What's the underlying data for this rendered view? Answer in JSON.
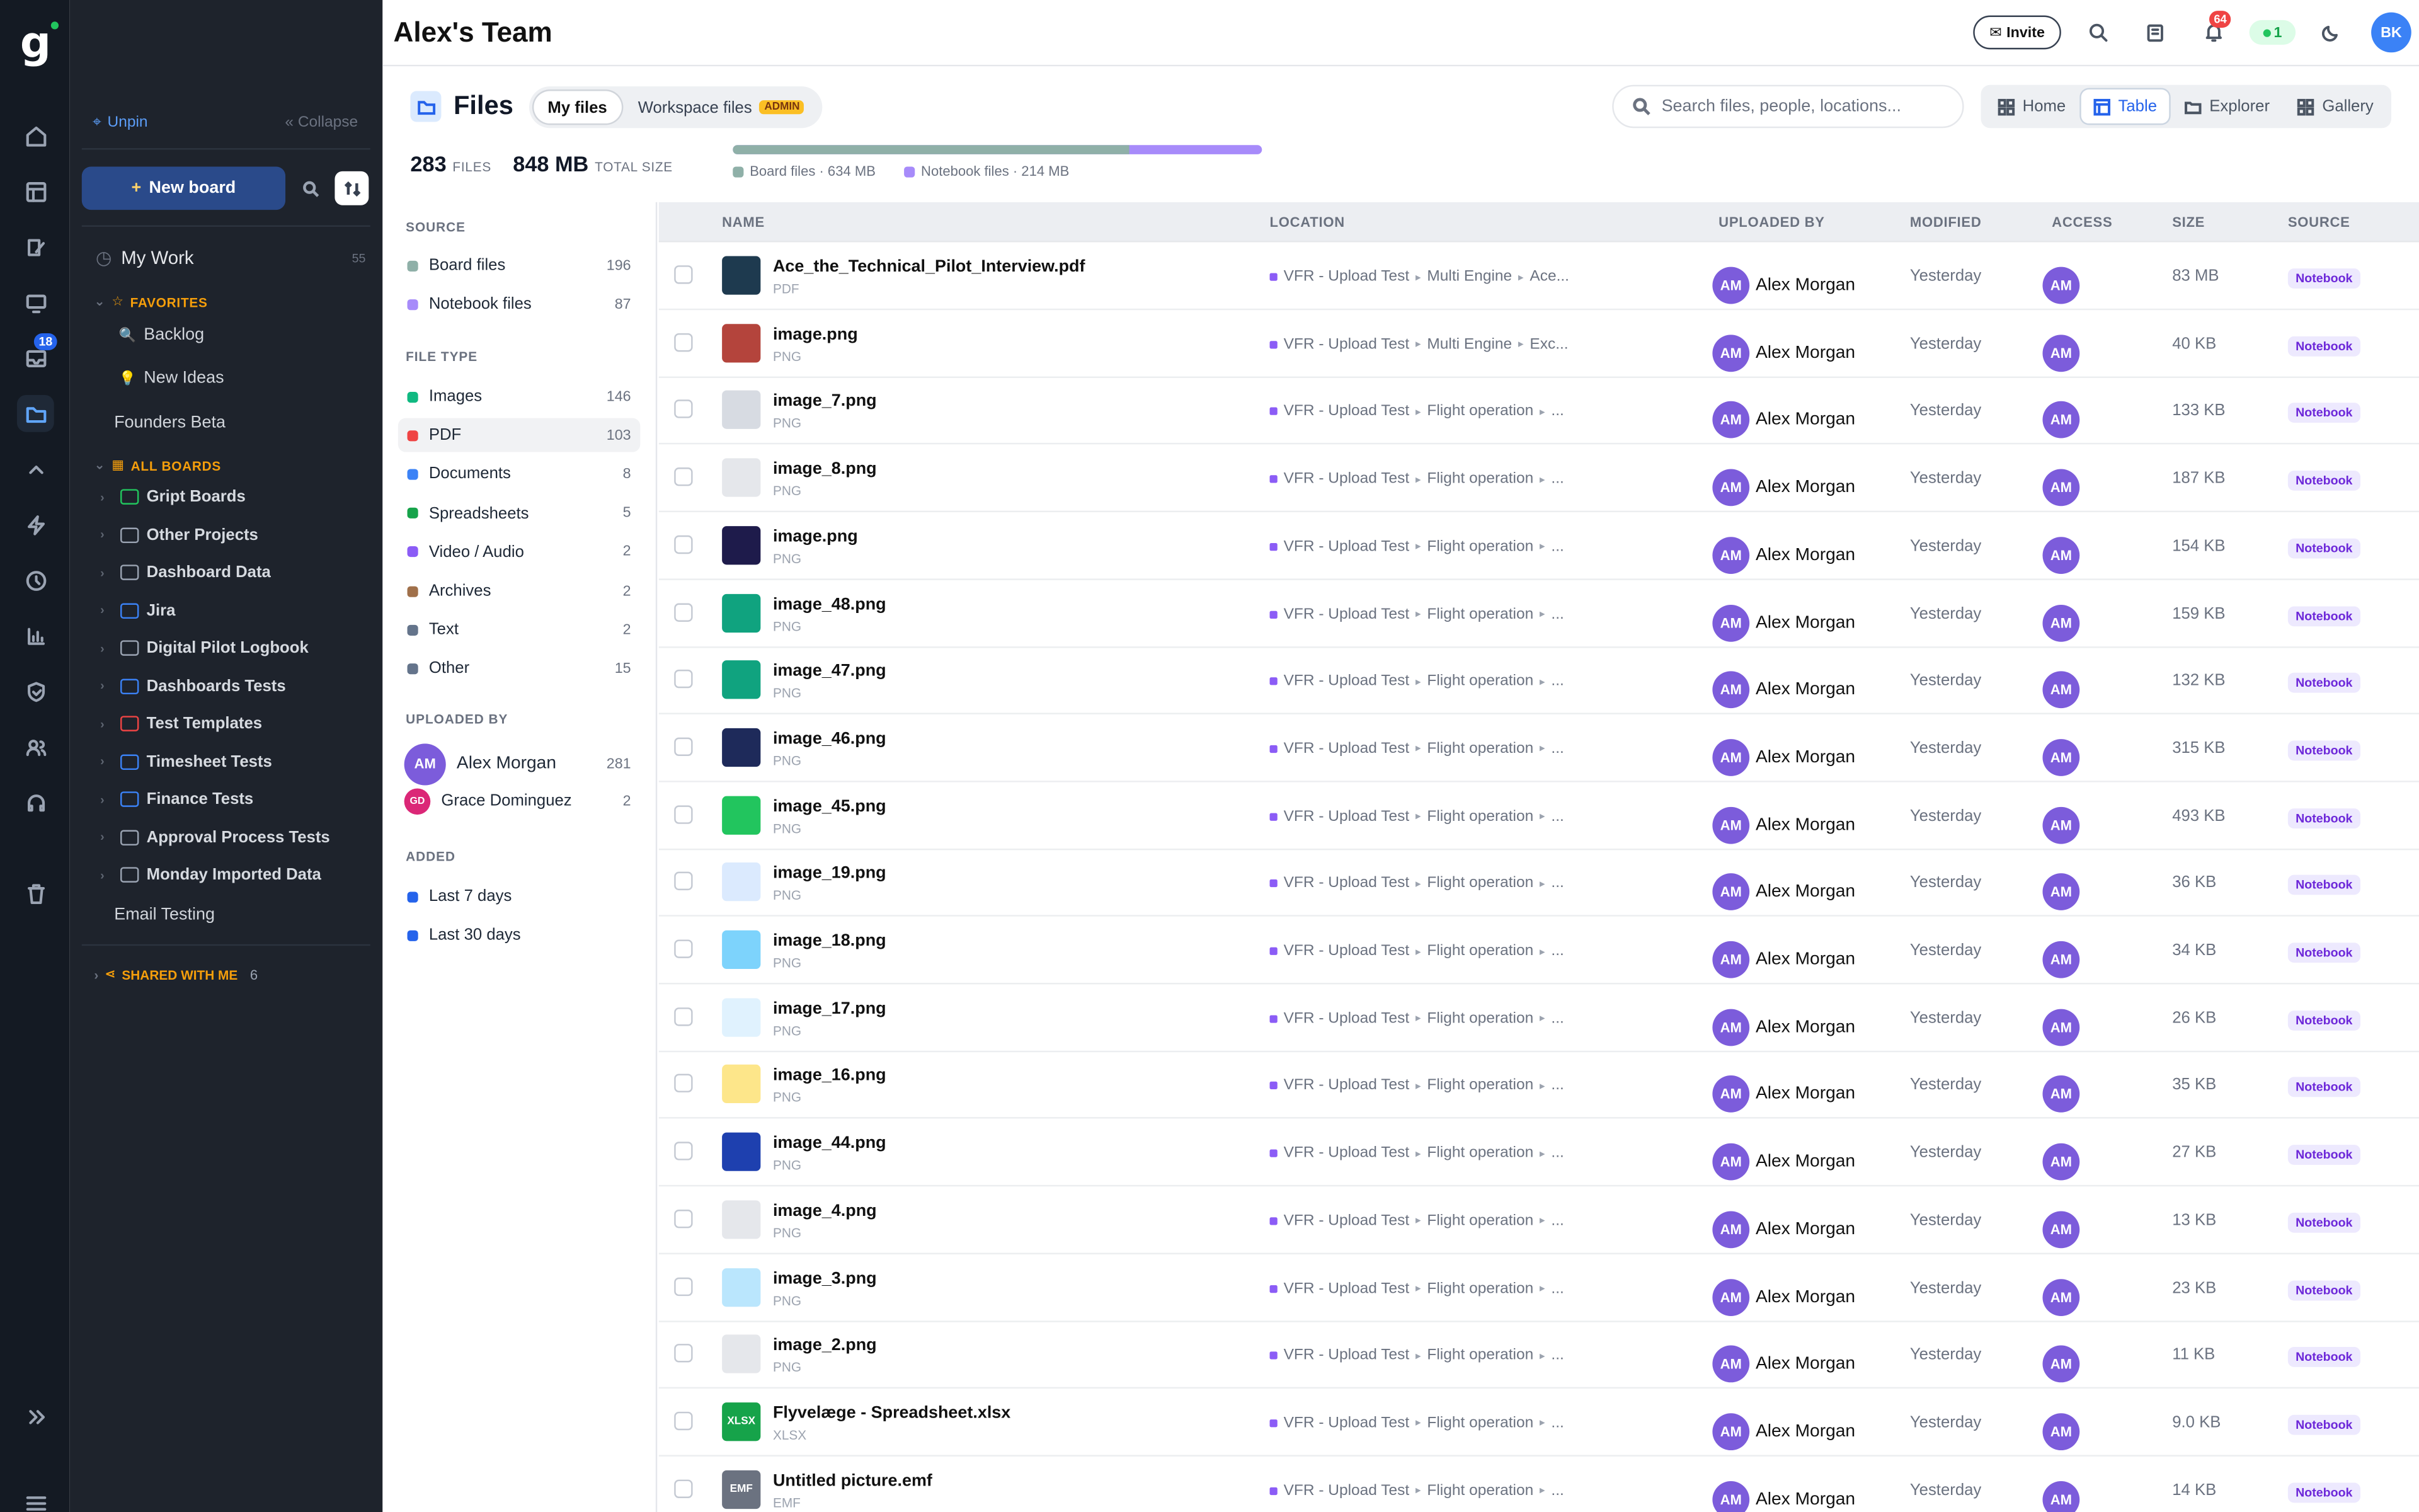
{
  "topbar": {
    "team": "Alex's Team",
    "invite": "Invite",
    "notifications": "64",
    "online": "1",
    "user_initials": "BK"
  },
  "rail": {
    "badge": "18"
  },
  "sidebar": {
    "unpin": "Unpin",
    "collapse": "Collapse",
    "new_board": "New board",
    "my_work": "My Work",
    "my_work_count": "55",
    "favorites_label": "FAVORITES",
    "favorites": [
      {
        "label": "Backlog",
        "emoji": "🔍"
      },
      {
        "label": "New Ideas",
        "emoji": "💡"
      }
    ],
    "founders": "Founders Beta",
    "all_boards_label": "ALL BOARDS",
    "boards": [
      {
        "label": "Gript Boards",
        "color": "#22c55e"
      },
      {
        "label": "Other Projects",
        "color": "#9aa3b2"
      },
      {
        "label": "Dashboard Data",
        "color": "#9aa3b2"
      },
      {
        "label": "Jira",
        "color": "#3b82f6"
      },
      {
        "label": "Digital Pilot Logbook",
        "color": "#9aa3b2"
      },
      {
        "label": "Dashboards Tests",
        "color": "#3b82f6"
      },
      {
        "label": "Test Templates",
        "color": "#ef4444"
      },
      {
        "label": "Timesheet Tests",
        "color": "#3b82f6"
      },
      {
        "label": "Finance Tests",
        "color": "#3b82f6"
      },
      {
        "label": "Approval Process Tests",
        "color": "#9aa3b2"
      },
      {
        "label": "Monday Imported Data",
        "color": "#9aa3b2"
      }
    ],
    "email_testing": "Email Testing",
    "shared_label": "SHARED WITH ME",
    "shared_count": "6"
  },
  "files": {
    "title": "Files",
    "tab_my": "My files",
    "tab_workspace": "Workspace files",
    "admin_badge": "ADMIN",
    "search_placeholder": "Search files, people, locations...",
    "views": [
      "Home",
      "Table",
      "Explorer",
      "Gallery"
    ],
    "count": "283",
    "count_label": "FILES",
    "size": "848 MB",
    "size_label": "TOTAL SIZE",
    "legend_board": "Board files · 634 MB",
    "legend_notebook": "Notebook files · 214 MB",
    "board_fraction": 0.748
  },
  "filters": {
    "source_label": "SOURCE",
    "source": [
      {
        "label": "Board files",
        "count": "196",
        "color": "#8fb0a8"
      },
      {
        "label": "Notebook files",
        "count": "87",
        "color": "#a78bfa"
      }
    ],
    "type_label": "FILE TYPE",
    "types": [
      {
        "label": "Images",
        "count": "146",
        "color": "#10b981"
      },
      {
        "label": "PDF",
        "count": "103",
        "color": "#ef4444"
      },
      {
        "label": "Documents",
        "count": "8",
        "color": "#3b82f6"
      },
      {
        "label": "Spreadsheets",
        "count": "5",
        "color": "#16a34a"
      },
      {
        "label": "Video / Audio",
        "count": "2",
        "color": "#8b5cf6"
      },
      {
        "label": "Archives",
        "count": "2",
        "color": "#a0704a"
      },
      {
        "label": "Text",
        "count": "2",
        "color": "#64748b"
      },
      {
        "label": "Other",
        "count": "15",
        "color": "#64748b"
      }
    ],
    "uploaded_label": "UPLOADED BY",
    "uploaders": [
      {
        "initials": "AM",
        "name": "Alex Morgan",
        "count": "281",
        "color": "#7c5cdb"
      },
      {
        "initials": "GD",
        "name": "Grace Dominguez",
        "count": "2",
        "color": "#db2777"
      }
    ],
    "added_label": "ADDED",
    "added": [
      {
        "label": "Last 7 days",
        "color": "#2563eb"
      },
      {
        "label": "Last 30 days",
        "color": "#2563eb"
      }
    ]
  },
  "table": {
    "columns": [
      "NAME",
      "LOCATION",
      "UPLOADED BY",
      "MODIFIED",
      "ACCESS",
      "SIZE",
      "SOURCE"
    ],
    "rows": [
      {
        "name": "Ace_the_Technical_Pilot_Interview.pdf",
        "type": "PDF",
        "loc": [
          "VFR - Upload Test",
          "Multi Engine",
          "Ace..."
        ],
        "by": "Alex Morgan",
        "modified": "Yesterday",
        "size": "83 MB",
        "source": "Notebook",
        "thumb": "#1e3a4f",
        "tl": ""
      },
      {
        "name": "image.png",
        "type": "PNG",
        "loc": [
          "VFR - Upload Test",
          "Multi Engine",
          "Exc..."
        ],
        "by": "Alex Morgan",
        "modified": "Yesterday",
        "size": "40 KB",
        "source": "Notebook",
        "thumb": "#b4443c",
        "tl": ""
      },
      {
        "name": "image_7.png",
        "type": "PNG",
        "loc": [
          "VFR - Upload Test",
          "Flight operation",
          "..."
        ],
        "by": "Alex Morgan",
        "modified": "Yesterday",
        "size": "133 KB",
        "source": "Notebook",
        "thumb": "#d7dbe2",
        "tl": ""
      },
      {
        "name": "image_8.png",
        "type": "PNG",
        "loc": [
          "VFR - Upload Test",
          "Flight operation",
          "..."
        ],
        "by": "Alex Morgan",
        "modified": "Yesterday",
        "size": "187 KB",
        "source": "Notebook",
        "thumb": "#e5e7eb",
        "tl": ""
      },
      {
        "name": "image.png",
        "type": "PNG",
        "loc": [
          "VFR - Upload Test",
          "Flight operation",
          "..."
        ],
        "by": "Alex Morgan",
        "modified": "Yesterday",
        "size": "154 KB",
        "source": "Notebook",
        "thumb": "#1e1b4b",
        "tl": ""
      },
      {
        "name": "image_48.png",
        "type": "PNG",
        "loc": [
          "VFR - Upload Test",
          "Flight operation",
          "..."
        ],
        "by": "Alex Morgan",
        "modified": "Yesterday",
        "size": "159 KB",
        "source": "Notebook",
        "thumb": "#10a37f",
        "tl": ""
      },
      {
        "name": "image_47.png",
        "type": "PNG",
        "loc": [
          "VFR - Upload Test",
          "Flight operation",
          "..."
        ],
        "by": "Alex Morgan",
        "modified": "Yesterday",
        "size": "132 KB",
        "source": "Notebook",
        "thumb": "#10a37f",
        "tl": ""
      },
      {
        "name": "image_46.png",
        "type": "PNG",
        "loc": [
          "VFR - Upload Test",
          "Flight operation",
          "..."
        ],
        "by": "Alex Morgan",
        "modified": "Yesterday",
        "size": "315 KB",
        "source": "Notebook",
        "thumb": "#1e2a5a",
        "tl": ""
      },
      {
        "name": "image_45.png",
        "type": "PNG",
        "loc": [
          "VFR - Upload Test",
          "Flight operation",
          "..."
        ],
        "by": "Alex Morgan",
        "modified": "Yesterday",
        "size": "493 KB",
        "source": "Notebook",
        "thumb": "#22c55e",
        "tl": ""
      },
      {
        "name": "image_19.png",
        "type": "PNG",
        "loc": [
          "VFR - Upload Test",
          "Flight operation",
          "..."
        ],
        "by": "Alex Morgan",
        "modified": "Yesterday",
        "size": "36 KB",
        "source": "Notebook",
        "thumb": "#dbeafe",
        "tl": ""
      },
      {
        "name": "image_18.png",
        "type": "PNG",
        "loc": [
          "VFR - Upload Test",
          "Flight operation",
          "..."
        ],
        "by": "Alex Morgan",
        "modified": "Yesterday",
        "size": "34 KB",
        "source": "Notebook",
        "thumb": "#7dd3fc",
        "tl": ""
      },
      {
        "name": "image_17.png",
        "type": "PNG",
        "loc": [
          "VFR - Upload Test",
          "Flight operation",
          "..."
        ],
        "by": "Alex Morgan",
        "modified": "Yesterday",
        "size": "26 KB",
        "source": "Notebook",
        "thumb": "#e0f2fe",
        "tl": ""
      },
      {
        "name": "image_16.png",
        "type": "PNG",
        "loc": [
          "VFR - Upload Test",
          "Flight operation",
          "..."
        ],
        "by": "Alex Morgan",
        "modified": "Yesterday",
        "size": "35 KB",
        "source": "Notebook",
        "thumb": "#fde68a",
        "tl": ""
      },
      {
        "name": "image_44.png",
        "type": "PNG",
        "loc": [
          "VFR - Upload Test",
          "Flight operation",
          "..."
        ],
        "by": "Alex Morgan",
        "modified": "Yesterday",
        "size": "27 KB",
        "source": "Notebook",
        "thumb": "#1e40af",
        "tl": ""
      },
      {
        "name": "image_4.png",
        "type": "PNG",
        "loc": [
          "VFR - Upload Test",
          "Flight operation",
          "..."
        ],
        "by": "Alex Morgan",
        "modified": "Yesterday",
        "size": "13 KB",
        "source": "Notebook",
        "thumb": "#e5e7eb",
        "tl": ""
      },
      {
        "name": "image_3.png",
        "type": "PNG",
        "loc": [
          "VFR - Upload Test",
          "Flight operation",
          "..."
        ],
        "by": "Alex Morgan",
        "modified": "Yesterday",
        "size": "23 KB",
        "source": "Notebook",
        "thumb": "#bae6fd",
        "tl": ""
      },
      {
        "name": "image_2.png",
        "type": "PNG",
        "loc": [
          "VFR - Upload Test",
          "Flight operation",
          "..."
        ],
        "by": "Alex Morgan",
        "modified": "Yesterday",
        "size": "11 KB",
        "source": "Notebook",
        "thumb": "#e5e7eb",
        "tl": ""
      },
      {
        "name": "Flyvelæge - Spreadsheet.xlsx",
        "type": "XLSX",
        "loc": [
          "VFR - Upload Test",
          "Flight operation",
          "..."
        ],
        "by": "Alex Morgan",
        "modified": "Yesterday",
        "size": "9.0 KB",
        "source": "Notebook",
        "thumb": "#16a34a",
        "tl": "XLSX"
      },
      {
        "name": "Untitled picture.emf",
        "type": "EMF",
        "loc": [
          "VFR - Upload Test",
          "Flight operation",
          "..."
        ],
        "by": "Alex Morgan",
        "modified": "Yesterday",
        "size": "14 KB",
        "source": "Notebook",
        "thumb": "#6b7280",
        "tl": "EMF"
      }
    ]
  }
}
